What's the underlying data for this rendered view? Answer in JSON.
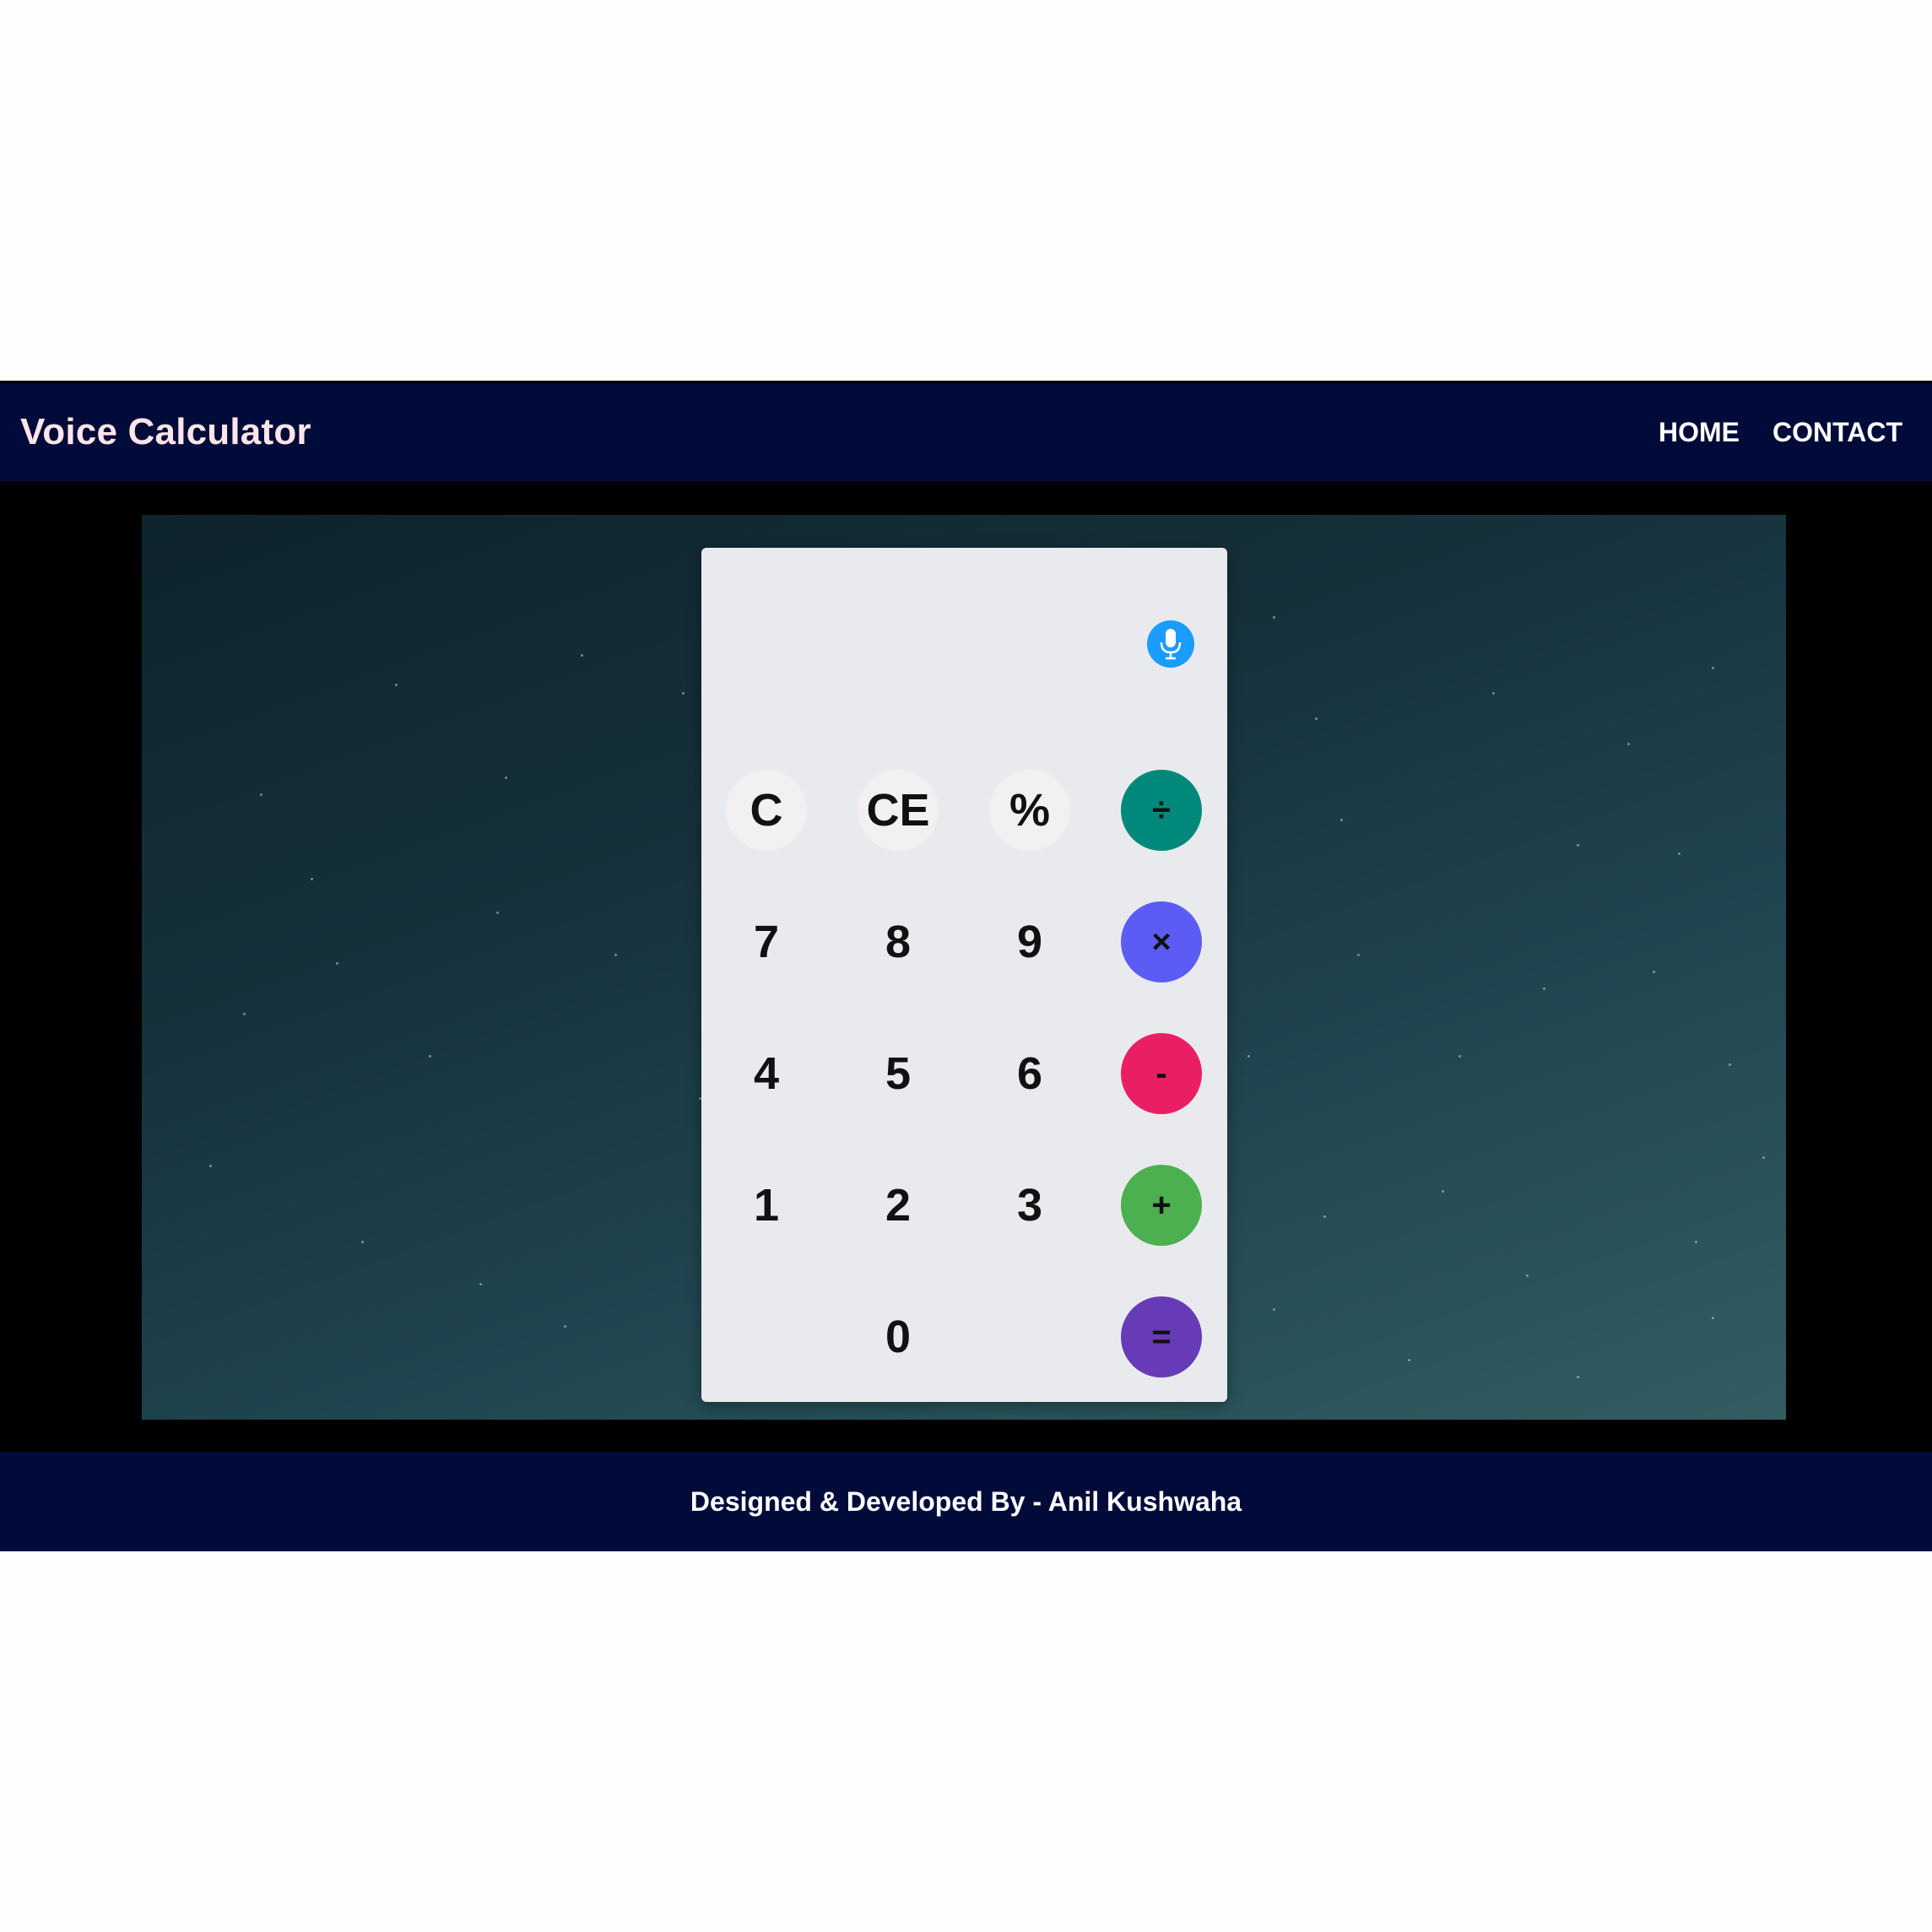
{
  "header": {
    "title": "Voice Calculator",
    "nav": [
      "HOME",
      "CONTACT"
    ]
  },
  "calculator": {
    "mic_icon": "microphone-icon",
    "keys": [
      {
        "label": "C",
        "kind": "function"
      },
      {
        "label": "CE",
        "kind": "function"
      },
      {
        "label": "%",
        "kind": "function"
      },
      {
        "label": "÷",
        "kind": "operator",
        "color": "#00897b"
      },
      {
        "label": "7",
        "kind": "digit"
      },
      {
        "label": "8",
        "kind": "digit"
      },
      {
        "label": "9",
        "kind": "digit"
      },
      {
        "label": "×",
        "kind": "operator",
        "color": "#5c5cf5"
      },
      {
        "label": "4",
        "kind": "digit"
      },
      {
        "label": "5",
        "kind": "digit"
      },
      {
        "label": "6",
        "kind": "digit"
      },
      {
        "label": "-",
        "kind": "operator",
        "color": "#ea1f63"
      },
      {
        "label": "1",
        "kind": "digit"
      },
      {
        "label": "2",
        "kind": "digit"
      },
      {
        "label": "3",
        "kind": "digit"
      },
      {
        "label": "+",
        "kind": "operator",
        "color": "#4caf50"
      },
      {
        "label": "0",
        "kind": "digit"
      },
      {
        "label": "=",
        "kind": "operator",
        "color": "#673ab7"
      }
    ]
  },
  "footer": {
    "credit": "Designed & Developed By - Anil Kushwaha"
  },
  "colors": {
    "navbar": "#000b3a",
    "mic": "#1a9cff",
    "panel": "#e9eaed"
  }
}
